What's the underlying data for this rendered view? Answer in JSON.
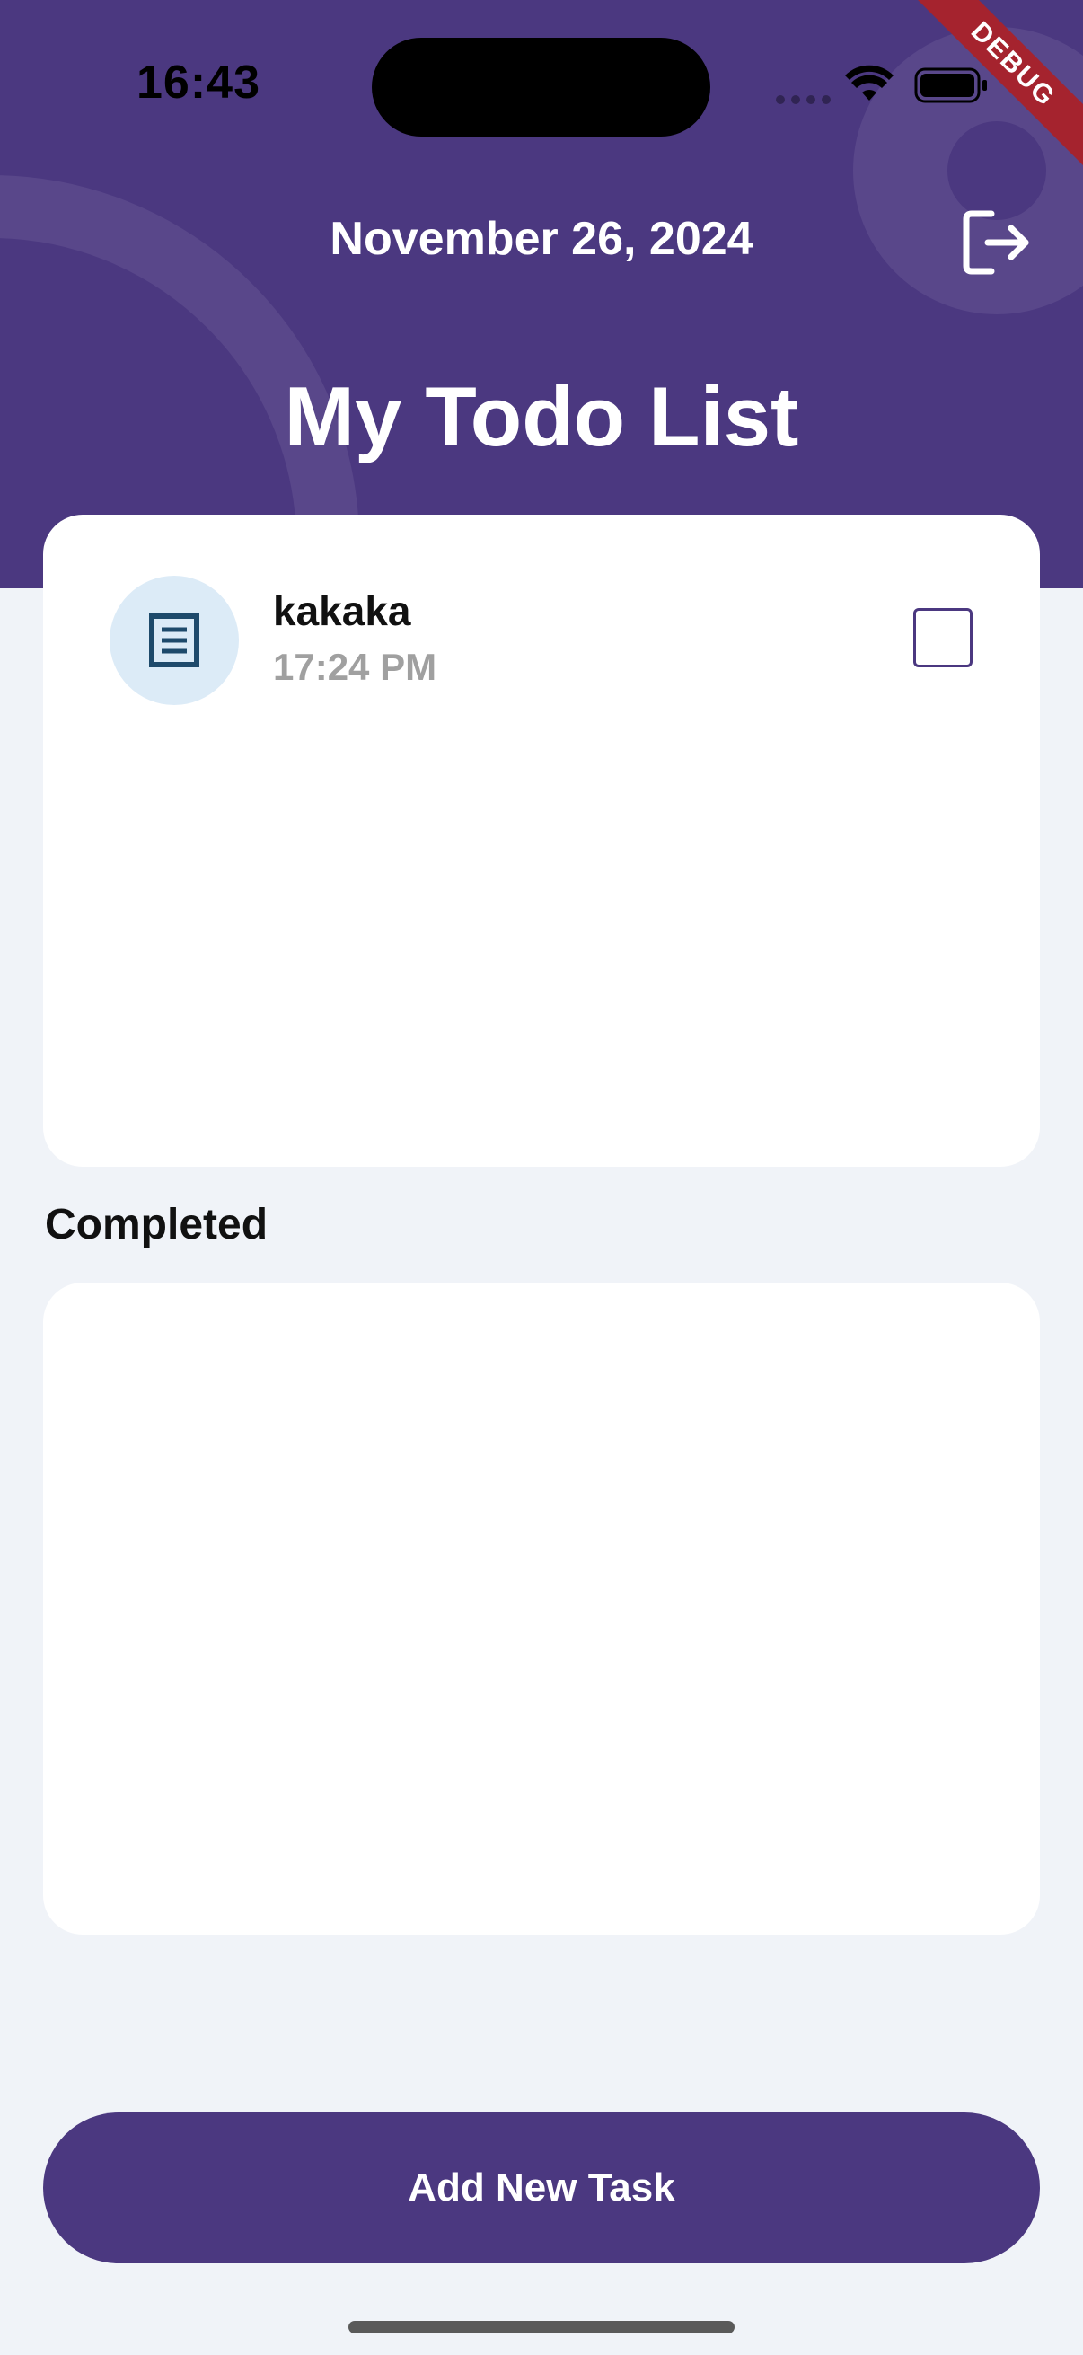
{
  "status_bar": {
    "time": "16:43",
    "icons": [
      "signal-dots-icon",
      "wifi-icon",
      "battery-icon"
    ]
  },
  "debug_banner": "DEBUG",
  "header": {
    "date": "November 26, 2024",
    "logout_icon": "logout-icon",
    "title": "My Todo List"
  },
  "todo": {
    "items": [
      {
        "title": "kakaka",
        "time": "17:24 PM",
        "icon": "document-icon",
        "completed": false
      }
    ]
  },
  "completed": {
    "heading": "Completed",
    "items": []
  },
  "actions": {
    "add_label": "Add New Task"
  },
  "colors": {
    "primary": "#4B3880",
    "background": "#F0F3F8",
    "card": "#FFFFFF",
    "task_icon_bg": "#DCEBF7",
    "task_icon": "#1E4A6B",
    "muted_text": "#A0A0A0",
    "debug": "#A5232E"
  }
}
